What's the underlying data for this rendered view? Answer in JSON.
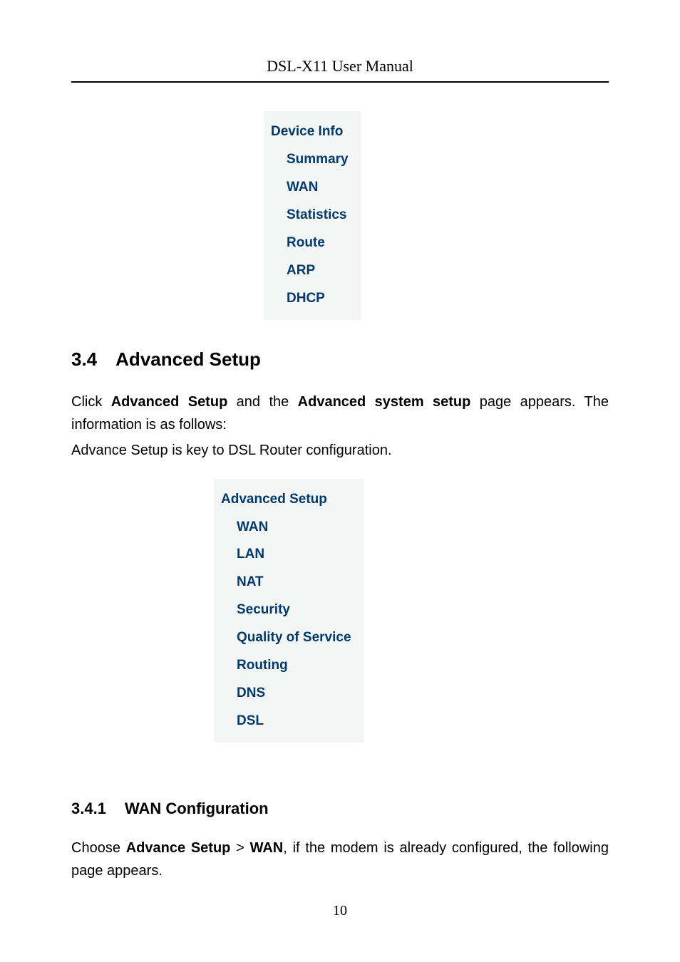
{
  "header": {
    "title": "DSL-X11 User Manual"
  },
  "deviceInfoMenu": {
    "title": "Device Info",
    "items": [
      "Summary",
      "WAN",
      "Statistics",
      "Route",
      "ARP",
      "DHCP"
    ]
  },
  "section34": {
    "number": "3.4",
    "title": "Advanced Setup",
    "para1": {
      "prefix": "Click ",
      "bold1": "Advanced Setup",
      "mid1": " and the ",
      "bold2": "Advanced system setup",
      "suffix": " page appears. The information is as follows:"
    },
    "para2": "Advance Setup is key to DSL Router configuration."
  },
  "advancedSetupMenu": {
    "title": "Advanced Setup",
    "items": [
      "WAN",
      "LAN",
      "NAT",
      "Security",
      "Quality of Service",
      "Routing",
      "DNS",
      "DSL"
    ]
  },
  "section341": {
    "number": "3.4.1",
    "title": "WAN Configuration",
    "para": {
      "prefix": "Choose ",
      "bold1": "Advance Setup",
      "mid1": " > ",
      "bold2": "WAN",
      "suffix": ", if the modem is already configured, the following page appears."
    }
  },
  "pageNumber": "10"
}
